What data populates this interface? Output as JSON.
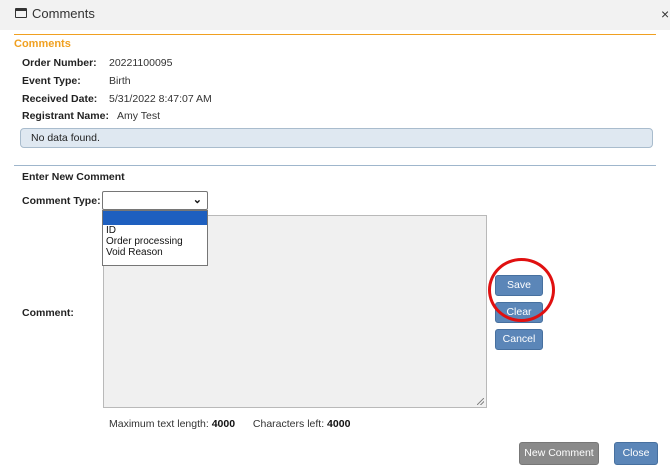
{
  "window": {
    "title": "Comments",
    "close_glyph": "×",
    "icon": "window-icon"
  },
  "section": {
    "title": "Comments"
  },
  "info": [
    {
      "label": "Order Number:",
      "value": "20221100095"
    },
    {
      "label": "Event Type:",
      "value": "Birth"
    },
    {
      "label": "Received Date:",
      "value": "5/31/2022 8:47:07 AM"
    },
    {
      "label": "Registrant Name:",
      "value": "Amy Test"
    }
  ],
  "grid": {
    "empty_message": "No data found."
  },
  "new_comment": {
    "title": "Enter New Comment",
    "type_label": "Comment Type:",
    "type_selected": "",
    "type_options": [
      "",
      "ID",
      "Order processing",
      "Void Reason"
    ],
    "comment_label": "Comment:",
    "comment_value": "",
    "max_length_label": "Maximum text length:",
    "max_length": "4000",
    "chars_left_label": "Characters left:",
    "chars_left": "4000"
  },
  "buttons": {
    "save": "Save",
    "clear": "Clear",
    "cancel": "Cancel",
    "new_comment": "New Comment",
    "close": "Close"
  },
  "colors": {
    "accent_orange": "#f0a020",
    "button_blue": "#5b86b8",
    "button_gray": "#8a8a8a",
    "highlight_red": "#e01010",
    "selected_option": "#1e5fbf"
  }
}
